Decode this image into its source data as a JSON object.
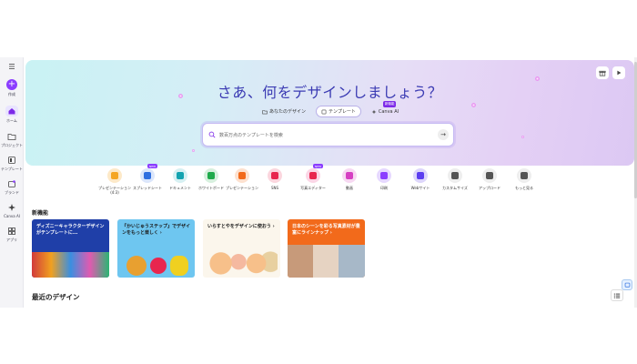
{
  "sidebar": {
    "menu_icon": "hamburger-icon",
    "items": [
      {
        "label": "作成",
        "icon": "plus-icon"
      },
      {
        "label": "ホーム",
        "icon": "home-icon"
      },
      {
        "label": "プロジェクト",
        "icon": "folder-icon"
      },
      {
        "label": "テンプレート",
        "icon": "template-icon"
      },
      {
        "label": "ブランド",
        "icon": "brand-icon"
      },
      {
        "label": "Canva AI",
        "icon": "sparkle-icon"
      },
      {
        "label": "アプリ",
        "icon": "apps-icon"
      }
    ]
  },
  "hero": {
    "title": "さあ、何をデザインしましょう？",
    "tabs": [
      {
        "label": "あなたのデザイン",
        "icon": "folder-icon"
      },
      {
        "label": "テンプレート",
        "icon": "template-icon"
      },
      {
        "label": "Canva AI",
        "icon": "sparkle-icon",
        "badge": "新機能"
      }
    ],
    "search_placeholder": "数百万点のテンプレートを検索"
  },
  "categories": [
    {
      "label": "プレゼンテーション (4:3)",
      "color": "#f5a623",
      "bg": "#fde9c8",
      "new": false
    },
    {
      "label": "スプレッドシート",
      "color": "#2f6fe0",
      "bg": "#dbe6fb",
      "new": true
    },
    {
      "label": "ドキュメント",
      "color": "#13a3b0",
      "bg": "#d6f0f2",
      "new": false
    },
    {
      "label": "ホワイトボード",
      "color": "#1faa4b",
      "bg": "#d7f0de",
      "new": false
    },
    {
      "label": "プレゼンテーション",
      "color": "#f26a1b",
      "bg": "#fde1cf",
      "new": false
    },
    {
      "label": "SNS",
      "color": "#e8264e",
      "bg": "#fbd6de",
      "new": false
    },
    {
      "label": "写真エディター",
      "color": "#e8264e",
      "bg": "#fbd6e6",
      "new": true
    },
    {
      "label": "動画",
      "color": "#d63fc2",
      "bg": "#f7d8f2",
      "new": false
    },
    {
      "label": "印刷",
      "color": "#8b3dff",
      "bg": "#e6d8ff",
      "new": false
    },
    {
      "label": "Webサイト",
      "color": "#5b3df0",
      "bg": "#ddd6fb",
      "new": false
    },
    {
      "label": "カスタムサイズ",
      "color": "#555555",
      "bg": "#eeeeee",
      "new": false
    },
    {
      "label": "アップロード",
      "color": "#555555",
      "bg": "#eeeeee",
      "new": false
    },
    {
      "label": "もっと見る",
      "color": "#555555",
      "bg": "#eeeeee",
      "new": false
    }
  ],
  "new_badge_text": "NEW",
  "new_features": {
    "heading": "新機能",
    "cards": [
      {
        "title": "ディズニーキャラクターデザインがテンプレートに...",
        "color": "#1f3fa8"
      },
      {
        "title": "『かいじゅうステップ』でデザインをもっと楽しく ›",
        "color": "#6ec6f0"
      },
      {
        "title": "いらすとやをデザインに使おう ›",
        "color": "#ffffff"
      },
      {
        "title": "日本のシーンを彩る写真素材が豊富にラインナップ ›",
        "color": "#f26a1b"
      }
    ]
  },
  "recent": {
    "heading": "最近のデザイン"
  }
}
